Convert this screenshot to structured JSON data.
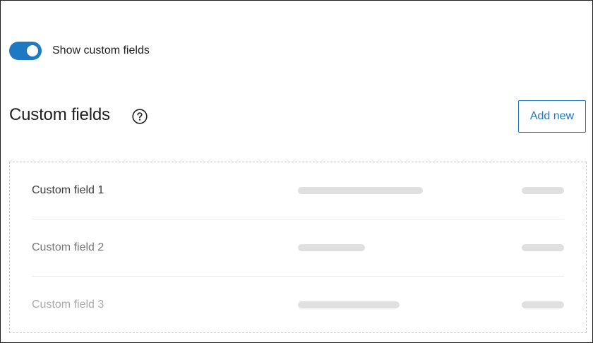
{
  "settings": {
    "show_custom_fields_label": "Show custom fields",
    "show_custom_fields_enabled": true
  },
  "header": {
    "title": "Custom fields",
    "help_icon": "question-circle-icon",
    "add_new_label": "Add new"
  },
  "fields": [
    {
      "label": "Custom field 1",
      "color": "#3c3c3c"
    },
    {
      "label": "Custom field 2",
      "color": "#787878"
    },
    {
      "label": "Custom field 3",
      "color": "#aaaaaa"
    }
  ],
  "colors": {
    "accent": "#1e78c2",
    "placeholder_bar": "#e0e0e0"
  }
}
